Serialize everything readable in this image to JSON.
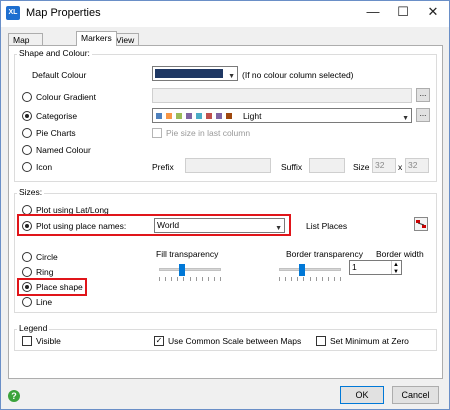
{
  "window": {
    "title": "Map Properties",
    "app_icon_text": "XL",
    "minimize_glyph": "—",
    "maximize_glyph": "☐",
    "close_glyph": "✕"
  },
  "tabs": [
    {
      "label": "Map from Range",
      "active": false
    },
    {
      "label": "Markers",
      "active": true
    },
    {
      "label": "View",
      "active": false
    }
  ],
  "shape_colour": {
    "group_label": "Shape and Colour:",
    "default_colour_label": "Default Colour",
    "default_colour_value": "#1f3864",
    "default_colour_note": "(If no colour column selected)",
    "colour_gradient_label": "Colour Gradient",
    "categorise_label": "Categorise",
    "palette_swatches": [
      "#4f81bd",
      "#f79646",
      "#9bbb59",
      "#8064a2",
      "#4bacc6",
      "#c0504d",
      "#8064a2",
      "#9e480e"
    ],
    "palette_name": "Light",
    "pie_charts_label": "Pie Charts",
    "pie_size_label": "Pie size in last column",
    "named_colour_label": "Named Colour",
    "icon_label": "Icon",
    "prefix_label": "Prefix",
    "suffix_label": "Suffix",
    "size_label": "Size",
    "size_w": "32",
    "size_x": "x",
    "size_h": "32",
    "ellipsis": "..."
  },
  "sizes": {
    "group_label": "Sizes:",
    "plot_latlong_label": "Plot using Lat/Long",
    "plot_place_label": "Plot using place names:",
    "place_value": "World",
    "list_places_label": "List Places",
    "circle_label": "Circle",
    "ring_label": "Ring",
    "place_shape_label": "Place shape",
    "line_label": "Line",
    "fill_transparency_label": "Fill transparency",
    "fill_transparency_level": 0.35,
    "border_transparency_label": "Border transparency",
    "border_transparency_level": 0.35,
    "border_width_label": "Border width",
    "border_width_value": "1"
  },
  "legend": {
    "group_label": "Legend",
    "visible_label": "Visible",
    "common_scale_label": "Use Common Scale between Maps",
    "set_min_zero_label": "Set Minimum at Zero"
  },
  "footer": {
    "help_glyph": "?",
    "ok_label": "OK",
    "cancel_label": "Cancel"
  },
  "colors": {
    "accent": "#0078d7",
    "highlight_box": "#e0151a"
  }
}
